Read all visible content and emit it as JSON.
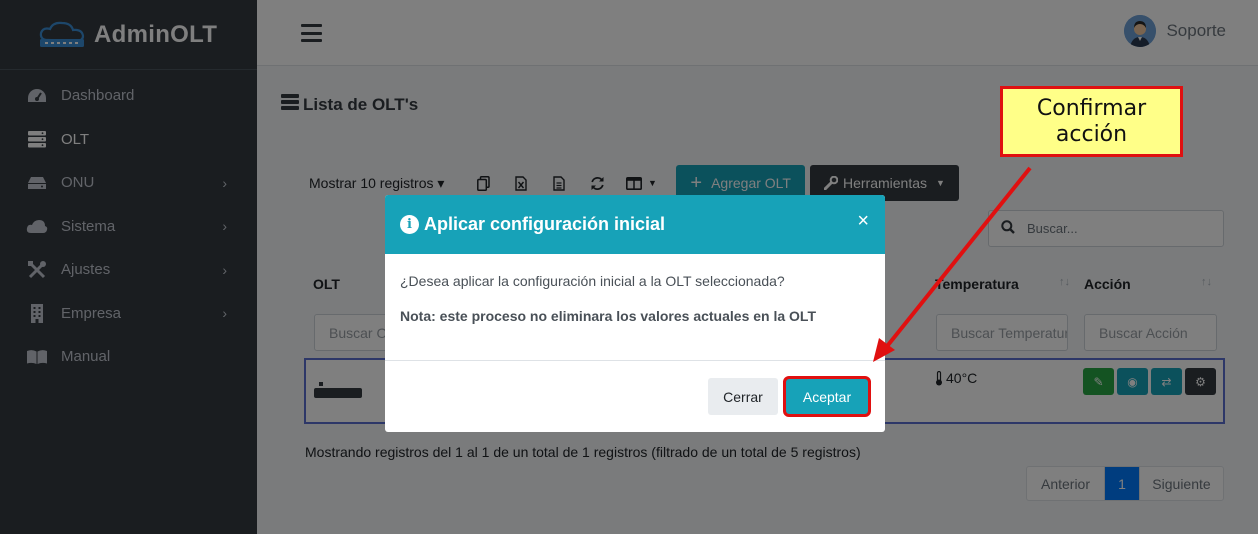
{
  "brand": {
    "name": "AdminOLT"
  },
  "sidebar": {
    "items": [
      {
        "label": "Dashboard",
        "icon": "tachometer-icon",
        "has_children": false
      },
      {
        "label": "OLT",
        "icon": "server-icon",
        "has_children": false,
        "active": true
      },
      {
        "label": "ONU",
        "icon": "hdd-icon",
        "has_children": true
      },
      {
        "label": "Sistema",
        "icon": "cloud-icon",
        "has_children": true
      },
      {
        "label": "Ajustes",
        "icon": "tools-icon",
        "has_children": true
      },
      {
        "label": "Empresa",
        "icon": "building-icon",
        "has_children": true
      },
      {
        "label": "Manual",
        "icon": "book-icon",
        "has_children": false
      }
    ]
  },
  "header": {
    "user_name": "Soporte"
  },
  "page": {
    "title": "Lista de OLT's",
    "toolbar": {
      "show_records": "Mostrar 10 registros",
      "add_label": "Agregar OLT",
      "tools_label": "Herramientas"
    },
    "search_placeholder": "Buscar...",
    "table": {
      "headers": [
        "OLT",
        "Temperatura",
        "Acción"
      ],
      "filters": [
        "Buscar OLT",
        "Buscar Temperatura",
        "Buscar Acción"
      ],
      "row": {
        "temperature": "40°C"
      }
    },
    "info": "Mostrando registros del 1 al 1 de un total de 1 registros (filtrado de un total de 5 registros)",
    "pagination": {
      "prev": "Anterior",
      "current": "1",
      "next": "Siguiente"
    }
  },
  "modal": {
    "title": "Aplicar configuración inicial",
    "close_symbol": "×",
    "question": "¿Desea aplicar la configuración inicial a la OLT seleccionada?",
    "note": "Nota: este proceso no eliminara los valores actuales en la OLT",
    "cancel_label": "Cerrar",
    "confirm_label": "Aceptar"
  },
  "annotation": {
    "text": "Confirmar acción"
  },
  "colors": {
    "sidebar_bg": "#343a40",
    "accent_info": "#17a2b8",
    "highlight_red": "#e01010",
    "callout_bg": "#ffff88",
    "primary": "#007bff"
  }
}
